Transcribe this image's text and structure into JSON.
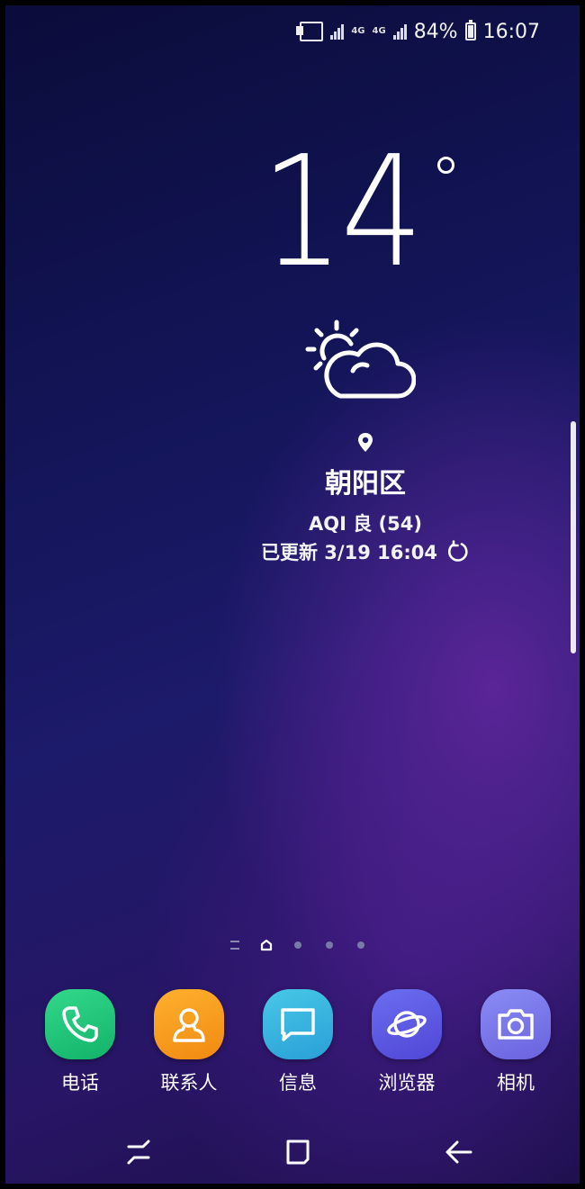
{
  "status_bar": {
    "network_primary": "4G",
    "network_secondary": "4G",
    "battery": "84%",
    "time": "16:07"
  },
  "weather": {
    "temperature": "14",
    "condition_icon": "partly-cloudy-icon",
    "location": "朝阳区",
    "aqi": "AQI 良 (54)",
    "updated": "已更新 3/19 16:04"
  },
  "page_indicator": {
    "pages": 5,
    "current": 1
  },
  "dock": {
    "apps": [
      {
        "label": "电话",
        "icon": "phone-icon",
        "color": "#1fc47a"
      },
      {
        "label": "联系人",
        "icon": "contacts-icon",
        "color": "#f89a1c"
      },
      {
        "label": "信息",
        "icon": "message-icon",
        "color": "#38b3e0"
      },
      {
        "label": "浏览器",
        "icon": "browser-planet-icon",
        "color": "#5d5ae3"
      },
      {
        "label": "相机",
        "icon": "camera-icon",
        "color": "#7a76ea"
      }
    ]
  },
  "nav_bar": {
    "buttons": [
      "recents-icon",
      "home-icon",
      "back-icon"
    ]
  }
}
